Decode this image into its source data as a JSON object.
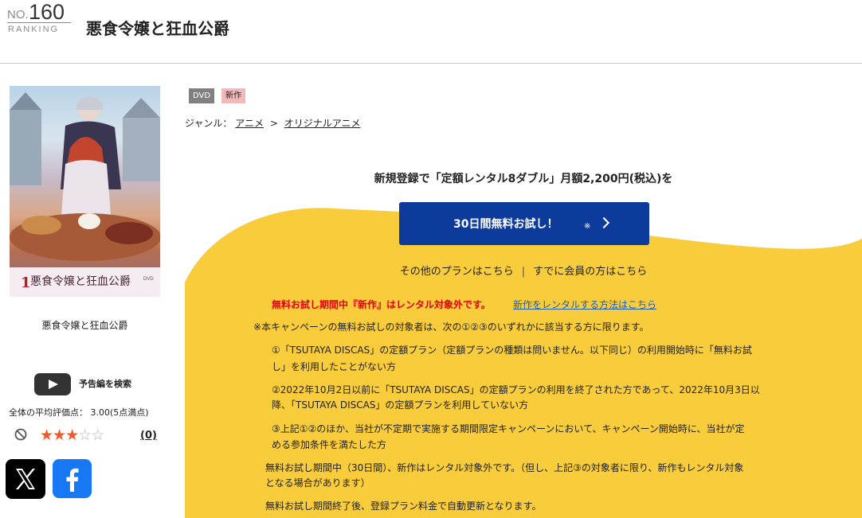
{
  "header": {
    "rank_prefix": "NO.",
    "rank_number": "160",
    "rank_label": "RANKING",
    "title": "悪食令嬢と狂血公爵"
  },
  "poster": {
    "caption": "悪食令嬢と狂血公爵",
    "art_title": "悪食令嬢と狂血公爵",
    "art_volume": "1",
    "art_badge": "DVD"
  },
  "trailer": {
    "label": "予告編を検索",
    "icon": "youtube-play-icon"
  },
  "rating": {
    "average_text": "全体の平均評価点： 3.00(5点満点)",
    "value": 3,
    "max": 5,
    "count_text": "(0)"
  },
  "social": {
    "x_icon": "x-logo-icon",
    "facebook_icon": "facebook-logo-icon"
  },
  "tags": [
    "DVD",
    "新作"
  ],
  "genre": {
    "label": "ジャンル：",
    "items": [
      "アニメ",
      "オリジナルアニメ"
    ],
    "separator": ">"
  },
  "campaign": {
    "headline": "新規登録で「定額レンタル8ダブル」月額2,200円(税込)を",
    "cta_label": "30日間無料お試し！",
    "cta_mark": "※",
    "other_plans": "その他のプランはこちら",
    "divider": "|",
    "member_link": "すでに会員の方はこちら",
    "warning": "無料お試し期間中『新作』はレンタル対象外です。",
    "warning_link": "新作をレンタルする方法はこちら",
    "note_intro": "※本キャンペーンの無料お試しの対象者は、次の①②③のいずれかに該当する方に限ります。",
    "cond1_l1": "①「TSUTAYA DISCAS」の定額プラン（定額プランの種類は問いません。以下同じ）の利用開始時に「無料お試",
    "cond1_l2": "し」を利用したことがない方",
    "cond2_l1": "②2022年10月2日以前に「TSUTAYA DISCAS」の定額プランの利用を終了された方であって、2022年10月3日以",
    "cond2_l2": "降、「TSUTAYA DISCAS」の定額プランを利用していない方",
    "cond3_l1": "③上記①②のほか、当社が不定期で実施する期間限定キャンペーンにおいて、キャンペーン開始時に、当社が定",
    "cond3_l2": "める参加条件を満たした方",
    "trial_l1": "無料お試し期間中（30日間）、新作はレンタル対象外です。（但し、上記③の対象者に限り、新作もレンタル対象",
    "trial_l2": "となる場合があります）",
    "renewal": "無料お試し期間終了後、登録プラン料金で自動更新となります。"
  },
  "colors": {
    "campaign_bg": "#f8cc3a",
    "cta_bg": "#0d3b9c",
    "warning": "#e60012",
    "link": "#1a5fb4",
    "star_on": "#f05a28",
    "facebook": "#1877f2"
  }
}
